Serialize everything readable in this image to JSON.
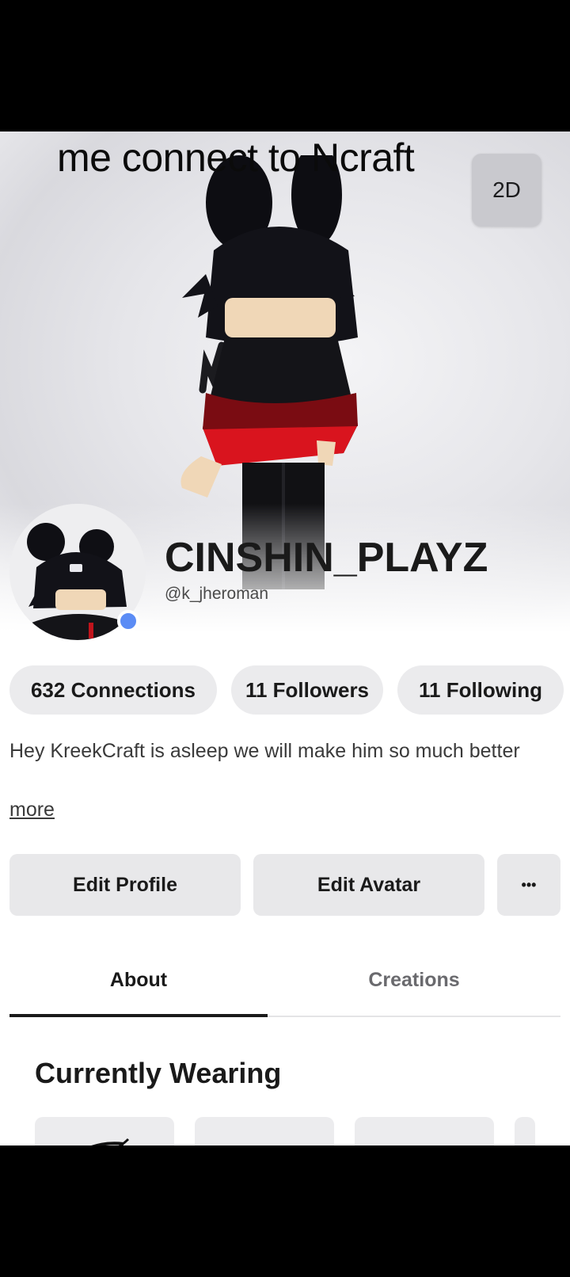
{
  "overlay": {
    "caption": "me connect to Ncraft"
  },
  "hero": {
    "view_toggle_label": "2D"
  },
  "profile": {
    "display_name": "CINSHIN_PLAYZ",
    "username": "@k_jheroman",
    "online_status_color": "#5b8cf5"
  },
  "stats": {
    "connections": "632 Connections",
    "followers": "11 Followers",
    "following": "11 Following"
  },
  "bio": {
    "text": "Hey KreekCraft is asleep we will make him so much better",
    "more_label": "more"
  },
  "actions": {
    "edit_profile": "Edit Profile",
    "edit_avatar": "Edit Avatar",
    "more_options": "•••"
  },
  "tabs": {
    "about": "About",
    "creations": "Creations",
    "active": "About"
  },
  "wearing": {
    "title": "Currently Wearing"
  }
}
